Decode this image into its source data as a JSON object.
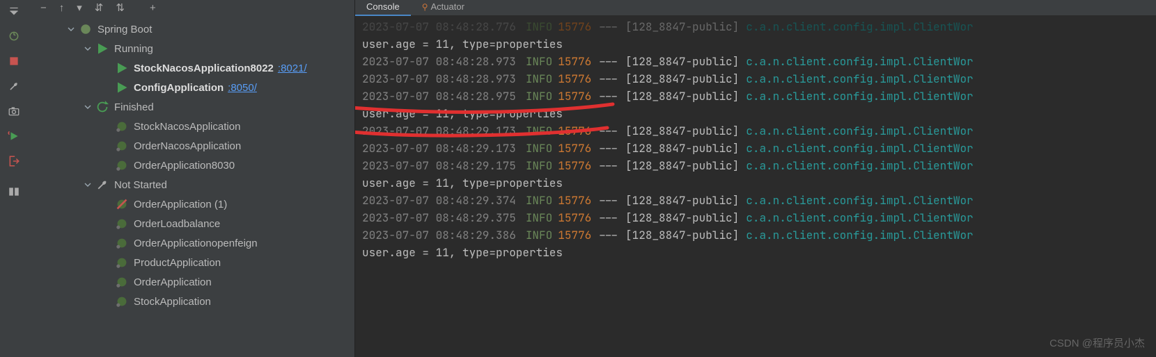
{
  "toolbar": {
    "icons": [
      "minus",
      "arrow-up",
      "funnel",
      "expand",
      "collapse",
      "add"
    ]
  },
  "gutter": {},
  "tree": {
    "root": {
      "label": "Spring Boot"
    },
    "running": {
      "label": "Running",
      "items": [
        {
          "name": "StockNacosApplication8022",
          "port": ":8021/"
        },
        {
          "name": "ConfigApplication",
          "port": ":8050/"
        }
      ]
    },
    "finished": {
      "label": "Finished",
      "items": [
        {
          "name": "StockNacosApplication"
        },
        {
          "name": "OrderNacosApplication"
        },
        {
          "name": "OrderApplication8030"
        }
      ]
    },
    "notstarted": {
      "label": "Not Started",
      "items": [
        {
          "name": "OrderApplication (1)",
          "error": true
        },
        {
          "name": "OrderLoadbalance"
        },
        {
          "name": "OrderApplicationopenfeign"
        },
        {
          "name": "ProductApplication"
        },
        {
          "name": "OrderApplication"
        },
        {
          "name": "StockApplication"
        }
      ]
    }
  },
  "tabs": {
    "console": "Console",
    "actuator": "Actuator"
  },
  "console": {
    "level": "INFO",
    "pid": "15776",
    "dash": "---",
    "thread": "[128_8847-public]",
    "class": "c.a.n.client.config.impl.ClientWor",
    "msg": "user.age = 11, type=properties",
    "rows": [
      {
        "ts": "2023-07-07 08:48:28.776",
        "type": "log",
        "dim": true
      },
      {
        "type": "msg"
      },
      {
        "ts": "2023-07-07 08:48:28.973",
        "type": "log"
      },
      {
        "ts": "2023-07-07 08:48:28.973",
        "type": "log"
      },
      {
        "ts": "2023-07-07 08:48:28.975",
        "type": "log"
      },
      {
        "type": "msg"
      },
      {
        "ts": "2023-07-07 08:48:29.173",
        "type": "log"
      },
      {
        "ts": "2023-07-07 08:48:29.173",
        "type": "log"
      },
      {
        "ts": "2023-07-07 08:48:29.175",
        "type": "log"
      },
      {
        "type": "msg"
      },
      {
        "ts": "2023-07-07 08:48:29.374",
        "type": "log"
      },
      {
        "ts": "2023-07-07 08:48:29.375",
        "type": "log"
      },
      {
        "ts": "2023-07-07 08:48:29.386",
        "type": "log"
      },
      {
        "type": "msg"
      }
    ]
  },
  "watermark": "CSDN @程序员小杰"
}
